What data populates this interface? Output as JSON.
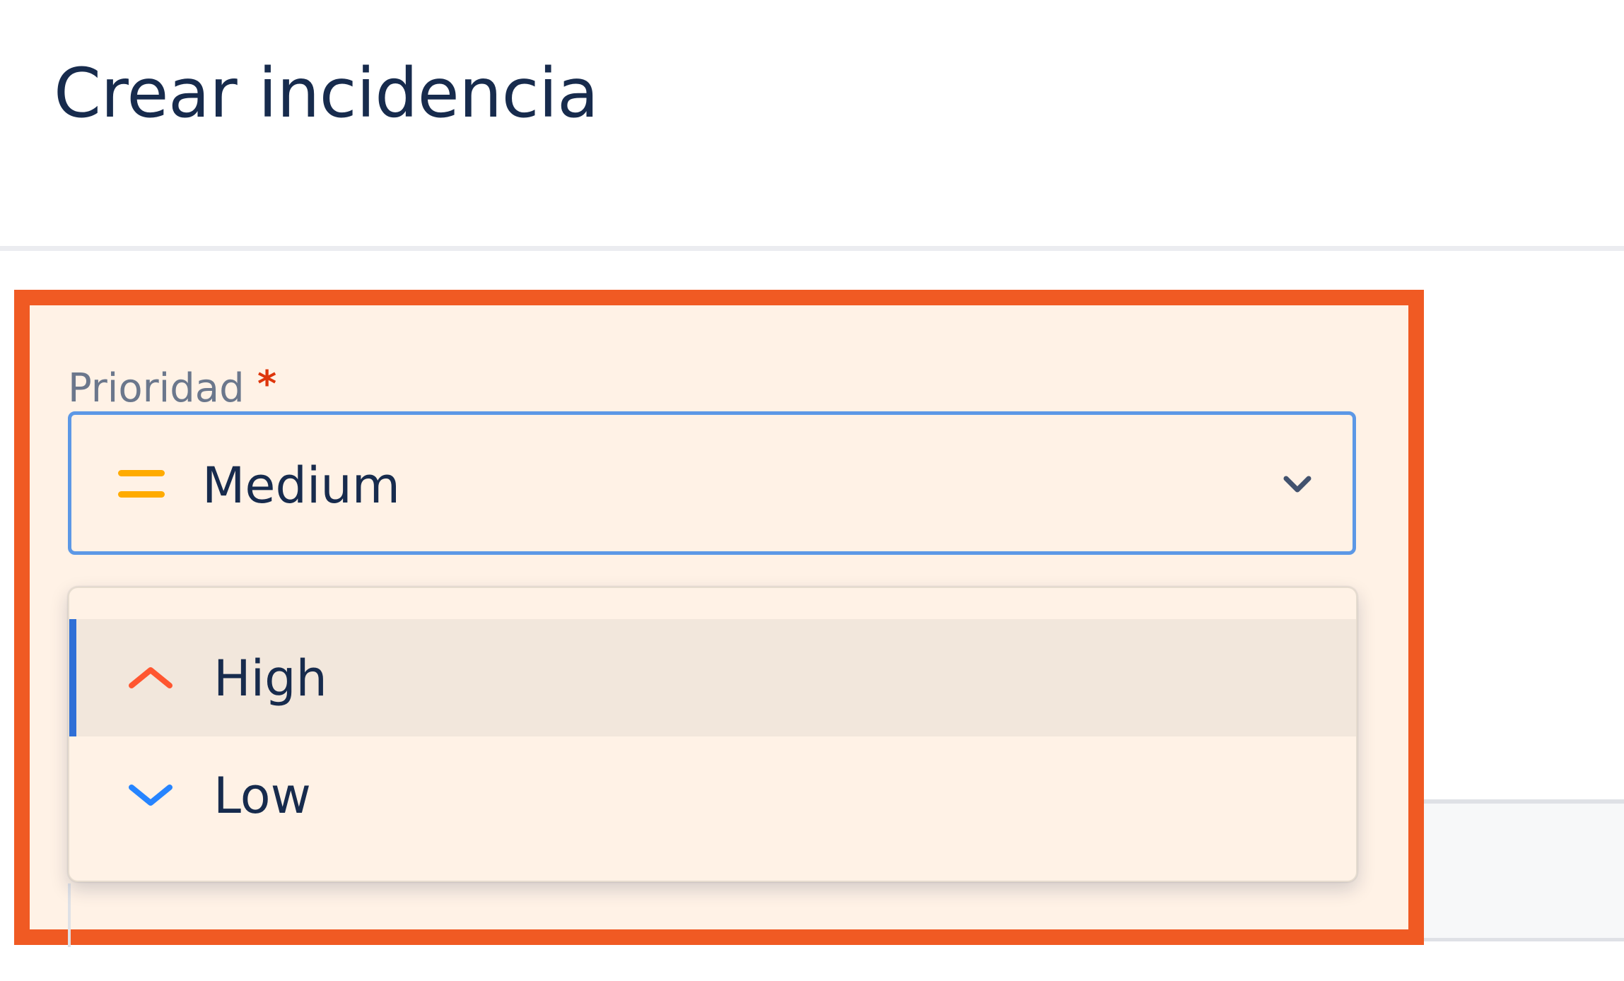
{
  "header": {
    "title": "Crear incidencia"
  },
  "priority_field": {
    "label": "Prioridad",
    "required_mark": "*",
    "selected": {
      "label": "Medium",
      "icon": "priority-medium-icon",
      "icon_color": "#FFAB00"
    },
    "options": [
      {
        "label": "High",
        "icon": "priority-high-icon",
        "icon_color": "#FF5630",
        "highlighted": true
      },
      {
        "label": "Low",
        "icon": "priority-low-icon",
        "icon_color": "#2684FF",
        "highlighted": false
      }
    ]
  },
  "colors": {
    "highlight_border": "#F05A23",
    "highlight_fill": "#FFF2E6",
    "focus_border": "#5C98E6",
    "active_indicator": "#2F6FD6",
    "text_primary": "#172B4D",
    "label_text": "#6B778C",
    "required": "#DE350B"
  }
}
